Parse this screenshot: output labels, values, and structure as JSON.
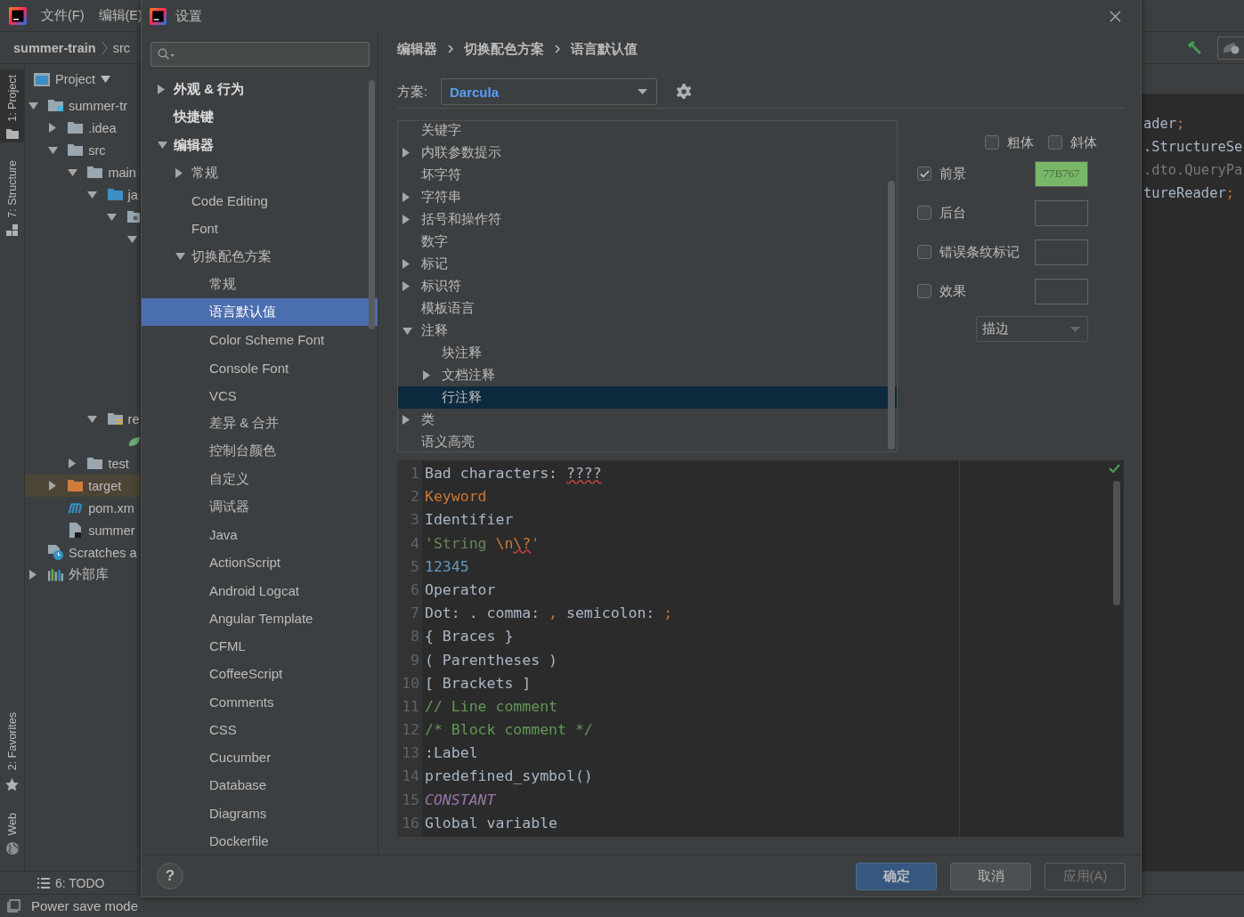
{
  "ide": {
    "menu": [
      {
        "label": "文件(F)"
      },
      {
        "label": "编辑(E)"
      }
    ],
    "nav_path": [
      "summer-train",
      "src"
    ],
    "stripe_top": [
      {
        "label": "1: Project",
        "kind": "project",
        "selected": true
      },
      {
        "label": "7: Structure",
        "kind": "structure",
        "selected": false
      }
    ],
    "stripe_bottom": [
      {
        "label": "2: Favorites",
        "kind": "favorites",
        "selected": false
      },
      {
        "label": "Web",
        "kind": "web",
        "selected": false
      }
    ],
    "project": {
      "title": "Project",
      "tree": [
        {
          "label": "summer-tr",
          "kind": "module",
          "expanded": true,
          "selected": false,
          "children": [
            {
              "label": ".idea",
              "kind": "folder",
              "expanded": false,
              "selected": false
            },
            {
              "label": "src",
              "kind": "folder",
              "expanded": true,
              "selected": false,
              "children": [
                {
                  "label": "main",
                  "kind": "folder",
                  "expanded": true,
                  "selected": false,
                  "children": [
                    {
                      "label": "ja",
                      "kind": "source",
                      "expanded": true,
                      "selected": false,
                      "children": [
                        {
                          "kind": "package",
                          "expanded": true,
                          "selected": false,
                          "children": [
                            {
                              "expanded": true,
                              "selected": false
                            }
                          ]
                        }
                      ]
                    },
                    {
                      "label": "re",
                      "kind": "resources",
                      "expanded": true,
                      "selected": false,
                      "children": [
                        {
                          "kind": "spring",
                          "selected": false
                        }
                      ]
                    }
                  ]
                },
                {
                  "label": "test",
                  "kind": "folder",
                  "expanded": false,
                  "selected": false
                }
              ]
            },
            {
              "label": "target",
              "kind": "excluded",
              "expanded": false,
              "selected": true
            },
            {
              "label": "pom.xm",
              "kind": "maven",
              "selected": false
            },
            {
              "label": "summer",
              "kind": "file",
              "selected": false
            }
          ]
        },
        {
          "label": "Scratches a",
          "kind": "scratches",
          "selected": false
        },
        {
          "label": "外部库",
          "kind": "library",
          "expanded": false,
          "selected": false
        }
      ]
    },
    "editor_lines": [
      [
        {
          "text": "ader",
          "kind": "plain"
        },
        {
          "text": ";",
          "kind": "semicolon"
        }
      ],
      [
        {
          "text": ".StructureSe",
          "kind": "plain"
        }
      ],
      [
        {
          "text": ".dto.QueryPa",
          "kind": "unused"
        }
      ],
      [
        {
          "text": "tureReader",
          "kind": "plain"
        },
        {
          "text": ";",
          "kind": "semicolon"
        }
      ]
    ],
    "bottom_tools": [
      {
        "label": "6: TODO",
        "kind": "todo"
      }
    ],
    "status": "Power save mode"
  },
  "dialog": {
    "title": "设置",
    "nav": [
      {
        "label": "外观 & 行为",
        "expanded": false,
        "selected": false
      },
      {
        "label": "快捷键",
        "selected": false
      },
      {
        "label": "编辑器",
        "expanded": true,
        "selected": false,
        "children": [
          {
            "label": "常规",
            "expanded": false,
            "selected": false
          },
          {
            "label": "Code Editing",
            "selected": false
          },
          {
            "label": "Font",
            "selected": false
          },
          {
            "label": "切换配色方案",
            "expanded": true,
            "selected": false,
            "children": [
              {
                "label": "常规",
                "selected": false
              },
              {
                "label": "语言默认值",
                "selected": true
              },
              {
                "label": "Color Scheme Font",
                "selected": false
              },
              {
                "label": "Console Font",
                "selected": false
              },
              {
                "label": "VCS",
                "selected": false
              },
              {
                "label": "差异 & 合并",
                "selected": false
              },
              {
                "label": "控制台颜色",
                "selected": false
              },
              {
                "label": "自定义",
                "selected": false
              },
              {
                "label": "调试器",
                "selected": false
              },
              {
                "label": "Java",
                "selected": false
              },
              {
                "label": "ActionScript",
                "selected": false
              },
              {
                "label": "Android Logcat",
                "selected": false
              },
              {
                "label": "Angular Template",
                "selected": false
              },
              {
                "label": "CFML",
                "selected": false
              },
              {
                "label": "CoffeeScript",
                "selected": false
              },
              {
                "label": "Comments",
                "selected": false
              },
              {
                "label": "CSS",
                "selected": false
              },
              {
                "label": "Cucumber",
                "selected": false
              },
              {
                "label": "Database",
                "selected": false
              },
              {
                "label": "Diagrams",
                "selected": false
              },
              {
                "label": "Dockerfile",
                "selected": false
              }
            ]
          }
        ]
      }
    ],
    "breadcrumb": [
      "编辑器",
      "切换配色方案",
      "语言默认值"
    ],
    "scheme": {
      "label": "方案:",
      "value": "Darcula"
    },
    "attributes": [
      {
        "label": "关键字",
        "selected": false
      },
      {
        "label": "内联参数提示",
        "expanded": false,
        "selected": false
      },
      {
        "label": "坏字符",
        "selected": false
      },
      {
        "label": "字符串",
        "expanded": false,
        "selected": false
      },
      {
        "label": "括号和操作符",
        "expanded": false,
        "selected": false
      },
      {
        "label": "数字",
        "selected": false
      },
      {
        "label": "标记",
        "expanded": false,
        "selected": false
      },
      {
        "label": "标识符",
        "expanded": false,
        "selected": false
      },
      {
        "label": "模板语言",
        "selected": false
      },
      {
        "label": "注释",
        "expanded": true,
        "selected": false,
        "children": [
          {
            "label": "块注释",
            "selected": false
          },
          {
            "label": "文档注释",
            "expanded": false,
            "selected": false
          },
          {
            "label": "行注释",
            "selected": true
          }
        ]
      },
      {
        "label": "类",
        "expanded": false,
        "selected": false
      },
      {
        "label": "语义高亮",
        "selected": false
      }
    ],
    "font_styles": [
      {
        "label": "粗体",
        "checked": false
      },
      {
        "label": "斜体",
        "checked": false
      }
    ],
    "color_rows": [
      {
        "label": "前景",
        "checked": true,
        "color": "#77b767",
        "value": "77B767"
      },
      {
        "label": "后台",
        "checked": false
      },
      {
        "label": "错误条纹标记",
        "checked": false
      },
      {
        "label": "效果",
        "checked": false
      }
    ],
    "effect": {
      "value": "描边",
      "disabled": true
    },
    "preview": [
      {
        "number": "1",
        "tokens": [
          {
            "text": "Bad characters: ",
            "kind": "plain"
          },
          {
            "text": "????",
            "kind": "bad"
          }
        ]
      },
      {
        "number": "2",
        "tokens": [
          {
            "text": "Keyword",
            "kind": "keyword"
          }
        ]
      },
      {
        "number": "3",
        "tokens": [
          {
            "text": "Identifier",
            "kind": "plain"
          }
        ]
      },
      {
        "number": "4",
        "tokens": [
          {
            "text": "'String ",
            "kind": "string"
          },
          {
            "text": "\\n",
            "kind": "escape"
          },
          {
            "text": "\\?",
            "kind": "invalid_escape"
          },
          {
            "text": "'",
            "kind": "string"
          }
        ]
      },
      {
        "number": "5",
        "tokens": [
          {
            "text": "12345",
            "kind": "number"
          }
        ]
      },
      {
        "number": "6",
        "tokens": [
          {
            "text": "Operator",
            "kind": "plain"
          }
        ]
      },
      {
        "number": "7",
        "tokens": [
          {
            "text": "Dot: ",
            "kind": "plain"
          },
          {
            "text": ".",
            "kind": "operator"
          },
          {
            "text": " comma: ",
            "kind": "plain"
          },
          {
            "text": ",",
            "kind": "comma"
          },
          {
            "text": " semicolon: ",
            "kind": "plain"
          },
          {
            "text": ";",
            "kind": "semicolon"
          }
        ]
      },
      {
        "number": "8",
        "tokens": [
          {
            "text": "{ Braces }",
            "kind": "plain"
          }
        ]
      },
      {
        "number": "9",
        "tokens": [
          {
            "text": "( Parentheses )",
            "kind": "plain"
          }
        ]
      },
      {
        "number": "10",
        "tokens": [
          {
            "text": "[ Brackets ]",
            "kind": "plain"
          }
        ]
      },
      {
        "number": "11",
        "tokens": [
          {
            "text": "// Line comment",
            "kind": "comment"
          }
        ]
      },
      {
        "number": "12",
        "tokens": [
          {
            "text": "/* Block comment */",
            "kind": "comment"
          }
        ]
      },
      {
        "number": "13",
        "tokens": [
          {
            "text": ":Label",
            "kind": "plain"
          }
        ]
      },
      {
        "number": "14",
        "tokens": [
          {
            "text": "predefined_symbol()",
            "kind": "plain"
          }
        ]
      },
      {
        "number": "15",
        "tokens": [
          {
            "text": "CONSTANT",
            "kind": "constant"
          }
        ]
      },
      {
        "number": "16",
        "tokens": [
          {
            "text": "Global variable",
            "kind": "plain"
          }
        ]
      }
    ],
    "help": "?",
    "buttons": [
      {
        "label": "确定",
        "kind": "primary"
      },
      {
        "label": "取消",
        "kind": "normal"
      },
      {
        "label": "应用(A)",
        "kind": "disabled"
      }
    ]
  }
}
